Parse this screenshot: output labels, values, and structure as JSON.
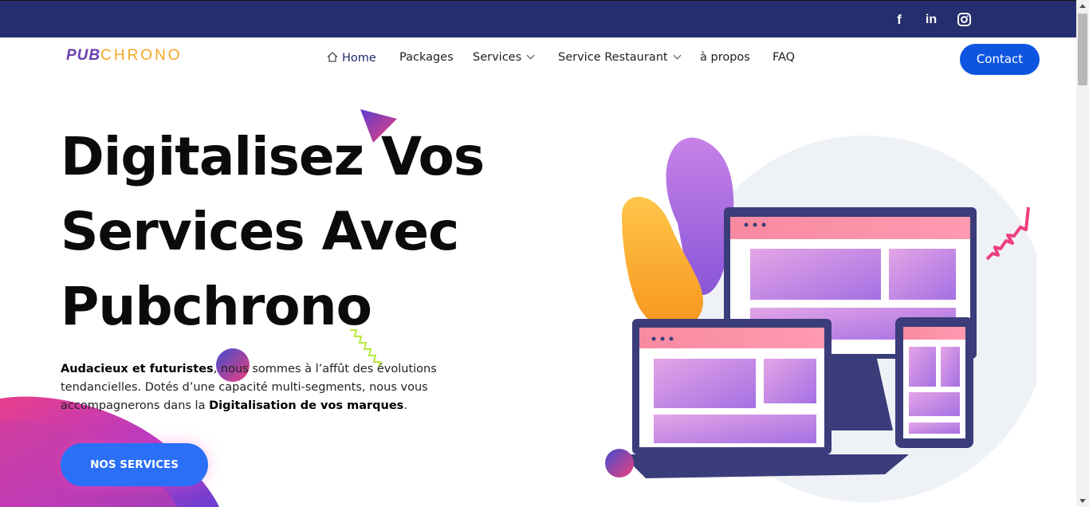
{
  "topbar": {
    "socials": [
      {
        "icon": "facebook-icon",
        "glyph": "f"
      },
      {
        "icon": "linkedin-icon",
        "glyph": "in"
      },
      {
        "icon": "instagram-icon",
        "glyph": ""
      }
    ]
  },
  "navbar": {
    "logo_part1": "PUB",
    "logo_part2": "CHRONO",
    "items": [
      {
        "label": "Home",
        "active": true
      },
      {
        "label": "Packages"
      },
      {
        "label": "Services",
        "dropdown": true
      },
      {
        "label": "Service Restaurant",
        "dropdown": true
      },
      {
        "label": "à propos"
      },
      {
        "label": "FAQ"
      }
    ],
    "contact_label": "Contact"
  },
  "hero": {
    "title_line1": "Digitalisez Vos",
    "title_line2": "Services Avec",
    "title_line3": "Pubchrono",
    "text_bold1": "Audacieux et futuristes",
    "text_mid1": ", nous sommes à l’affût des évolutions tendancielles. Dotés d’une capacité multi-segments, nous vous accompagnerons dans la ",
    "text_bold2": "Digitalisation de vos marques",
    "text_end": ".",
    "cta_label": "NOS SERVICES"
  },
  "colors": {
    "topbar": "#252e6e",
    "contact_button": "#0d55e0",
    "cta_button": "#2b6ff7",
    "logo_purple": "#6b3fb0",
    "logo_orange": "#f5a623"
  }
}
